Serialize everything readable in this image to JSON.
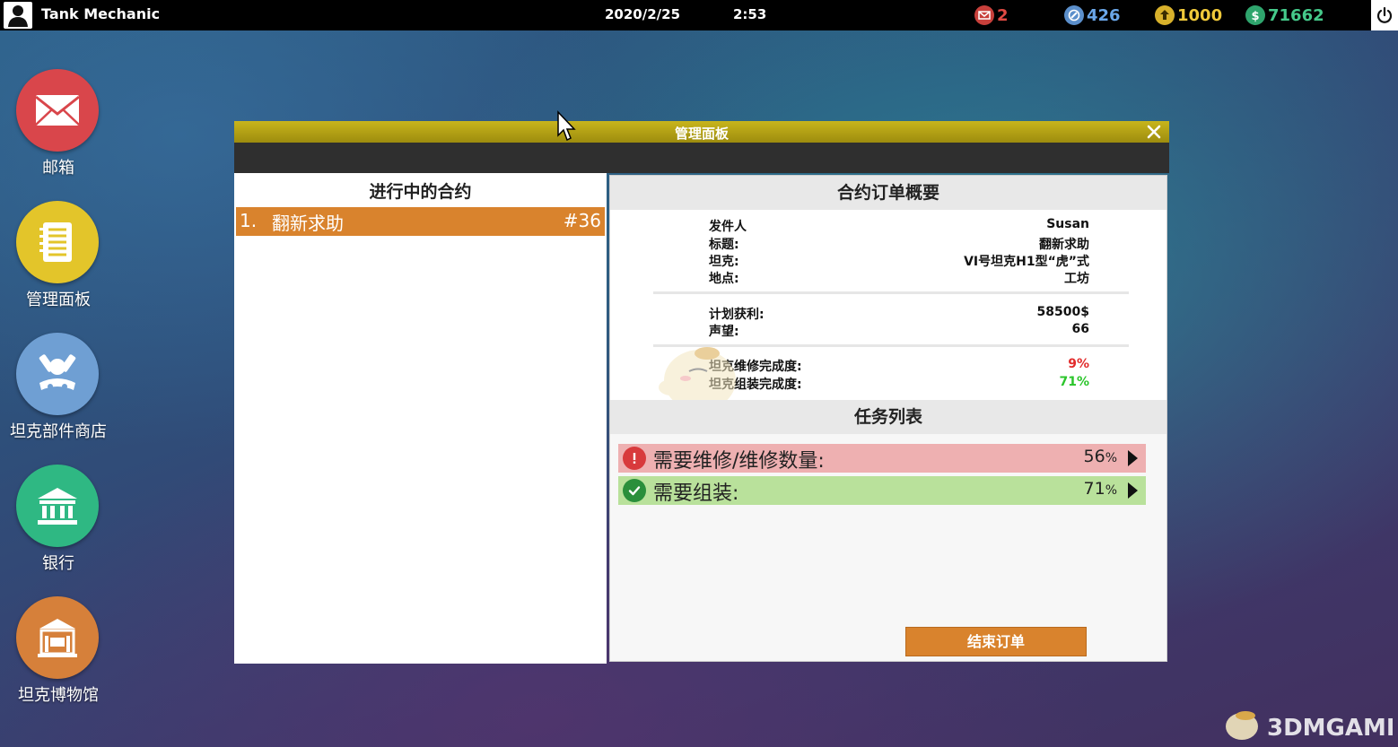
{
  "topbar": {
    "title": "Tank Mechanic",
    "date": "2020/2/25",
    "time": "2:53",
    "stats": {
      "mail": "2",
      "reputation": "426",
      "gold": "1000",
      "money": "71662"
    }
  },
  "desktop": {
    "mail": "邮箱",
    "panel": "管理面板",
    "shop": "坦克部件商店",
    "bank": "银行",
    "museum": "坦克博物馆"
  },
  "window": {
    "title": "管理面板",
    "left_header": "进行中的合约",
    "contracts": [
      {
        "num": "1.",
        "name": "翻新求助",
        "id": "#36"
      }
    ],
    "summary_header": "合约订单概要",
    "details": {
      "sender_label": "发件人",
      "sender": "Susan",
      "subject_label": "标题:",
      "subject": "翻新求助",
      "tank_label": "坦克:",
      "tank": "VI号坦克H1型“虎”式",
      "location_label": "地点:",
      "location": "工坊",
      "profit_label": "计划获利:",
      "profit": "58500$",
      "reputation_label": "声望:",
      "reputation": "66",
      "repair_label": "坦克维修完成度:",
      "repair": "9%",
      "assembly_label": "坦克组装完成度:",
      "assembly": "71%"
    },
    "task_header": "任务列表",
    "tasks": [
      {
        "label": "需要维修/维修数量:",
        "value": "56",
        "unit": "%"
      },
      {
        "label": "需要组装:",
        "value": "71",
        "unit": "%"
      }
    ],
    "end_button": "结束订单"
  },
  "watermark": "3DMGAME",
  "colors": {
    "title_bar": "#b3a114",
    "orange": "#d9832d",
    "task_red": "#eeb0b1",
    "task_green": "#b9e19b"
  }
}
